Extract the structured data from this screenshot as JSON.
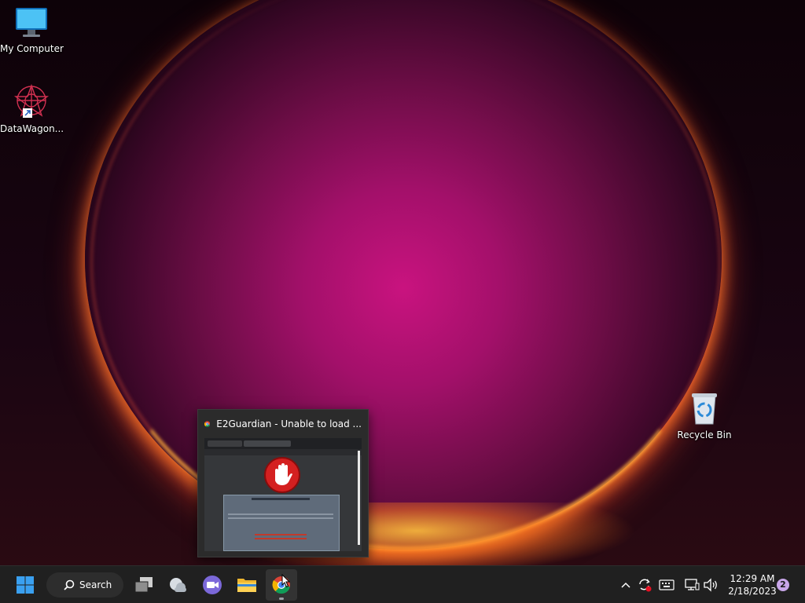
{
  "desktop": {
    "icons": [
      {
        "label": "My Computer"
      },
      {
        "label": "DataWagon..."
      },
      {
        "label": "Recycle Bin"
      }
    ]
  },
  "preview": {
    "title": "E2Guardian - Unable to load ..."
  },
  "taskbar": {
    "search_label": "Search",
    "clock_time": "12:29 AM",
    "clock_date": "2/18/2023",
    "notification_count": "2"
  },
  "colors": {
    "accent_blue": "#3aa0f0",
    "taskbar_bg": "#202020"
  }
}
